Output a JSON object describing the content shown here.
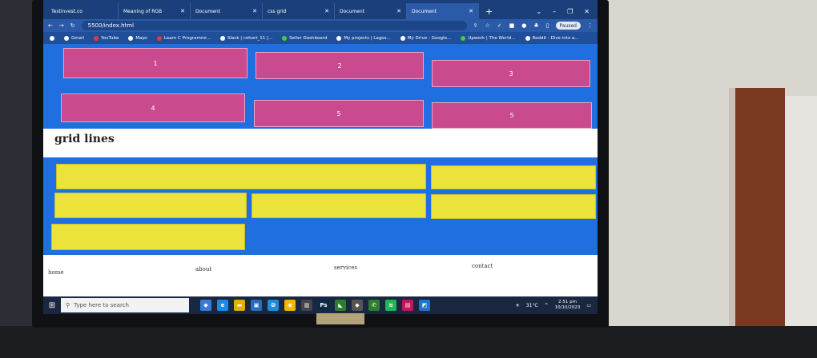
{
  "browser": {
    "tabs": [
      {
        "label": "Testinvest.co"
      },
      {
        "label": "Meaning of RGB"
      },
      {
        "label": "Document"
      },
      {
        "label": "css grid"
      },
      {
        "label": "Document"
      },
      {
        "label": "Document"
      }
    ],
    "active_tab_index": 5,
    "url": "5500/index.html",
    "profile_status": "Paused",
    "bookmarks": [
      {
        "label": "Gmail"
      },
      {
        "label": "YouTube"
      },
      {
        "label": "Maps"
      },
      {
        "label": "Learn C Programmi..."
      },
      {
        "label": "Slack | cohort_11 |..."
      },
      {
        "label": "Seller Dashboard"
      },
      {
        "label": "My projects | Lagos..."
      },
      {
        "label": "My Drive - Google..."
      },
      {
        "label": "Upwork | The World..."
      },
      {
        "label": "Reddit - Dive into a..."
      }
    ]
  },
  "page": {
    "grid_items": [
      "1",
      "2",
      "3",
      "4",
      "5",
      "5"
    ],
    "heading": "grid lines",
    "nav": {
      "home": "home",
      "about": "about",
      "services": "services",
      "contact": "contact"
    }
  },
  "taskbar": {
    "search_placeholder": "Type here to search",
    "temperature": "31°C",
    "time": "2:51 pm",
    "date": "10/10/2023"
  },
  "colors": {
    "page_blue": "#1f6fe0",
    "pink_item": "#c94a8f",
    "yellow_item": "#ece33a",
    "browser_dark": "#1b3f7a"
  }
}
